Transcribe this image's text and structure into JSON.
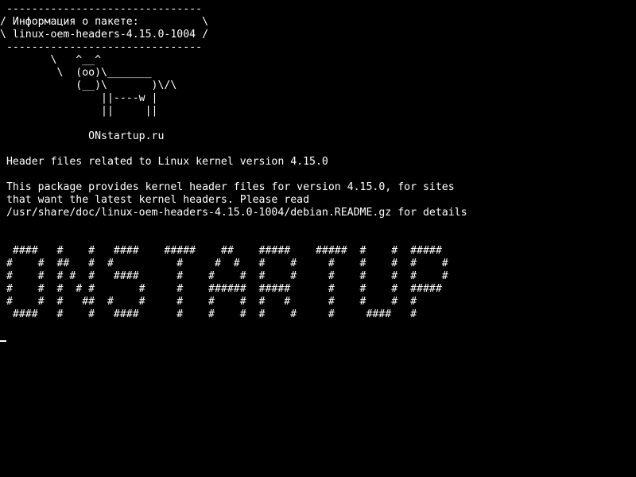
{
  "terminal": {
    "colors": {
      "background": "#000000",
      "foreground": "#ffffff"
    },
    "cowsay": {
      "bubble_top": " -------------------------------",
      "bubble_line1": "/ Информация о пакете:          \\",
      "bubble_line2": "\\ linux-oem-headers-4.15.0-1004 /",
      "bubble_bottom": " -------------------------------",
      "cow_line1": "        \\   ^__^",
      "cow_line2": "         \\  (oo)\\_______",
      "cow_line3": "            (__)\\       )\\/\\",
      "cow_line4": "                ||----w |",
      "cow_line5": "                ||     ||"
    },
    "site": "              ONstartup.ru",
    "description": {
      "summary": " Header files related to Linux kernel version 4.15.0",
      "body_line1": " This package provides kernel header files for version 4.15.0, for sites",
      "body_line2": " that want the latest kernel headers. Please read",
      "body_line3": " /usr/share/doc/linux-oem-headers-4.15.0-1004/debian.README.gz for details"
    },
    "banner": {
      "line1": "  ####   #    #   ####    #####    ##    #####    #####  #    #  #####",
      "line2": " #    #  ##   #  #          #     #  #   #    #     #    #    #  #    #",
      "line3": " #    #  # #  #   ####      #    #    #  #    #     #    #    #  #    #",
      "line4": " #    #  #  # #       #     #    ######  #####      #    #    #  #####",
      "line5": " #    #  #   ##  #    #     #    #    #  #   #      #    #    #  #",
      "line6": "  ####   #    #   ####      #    #    #  #    #     #     ####   #"
    },
    "cursor": "_"
  }
}
